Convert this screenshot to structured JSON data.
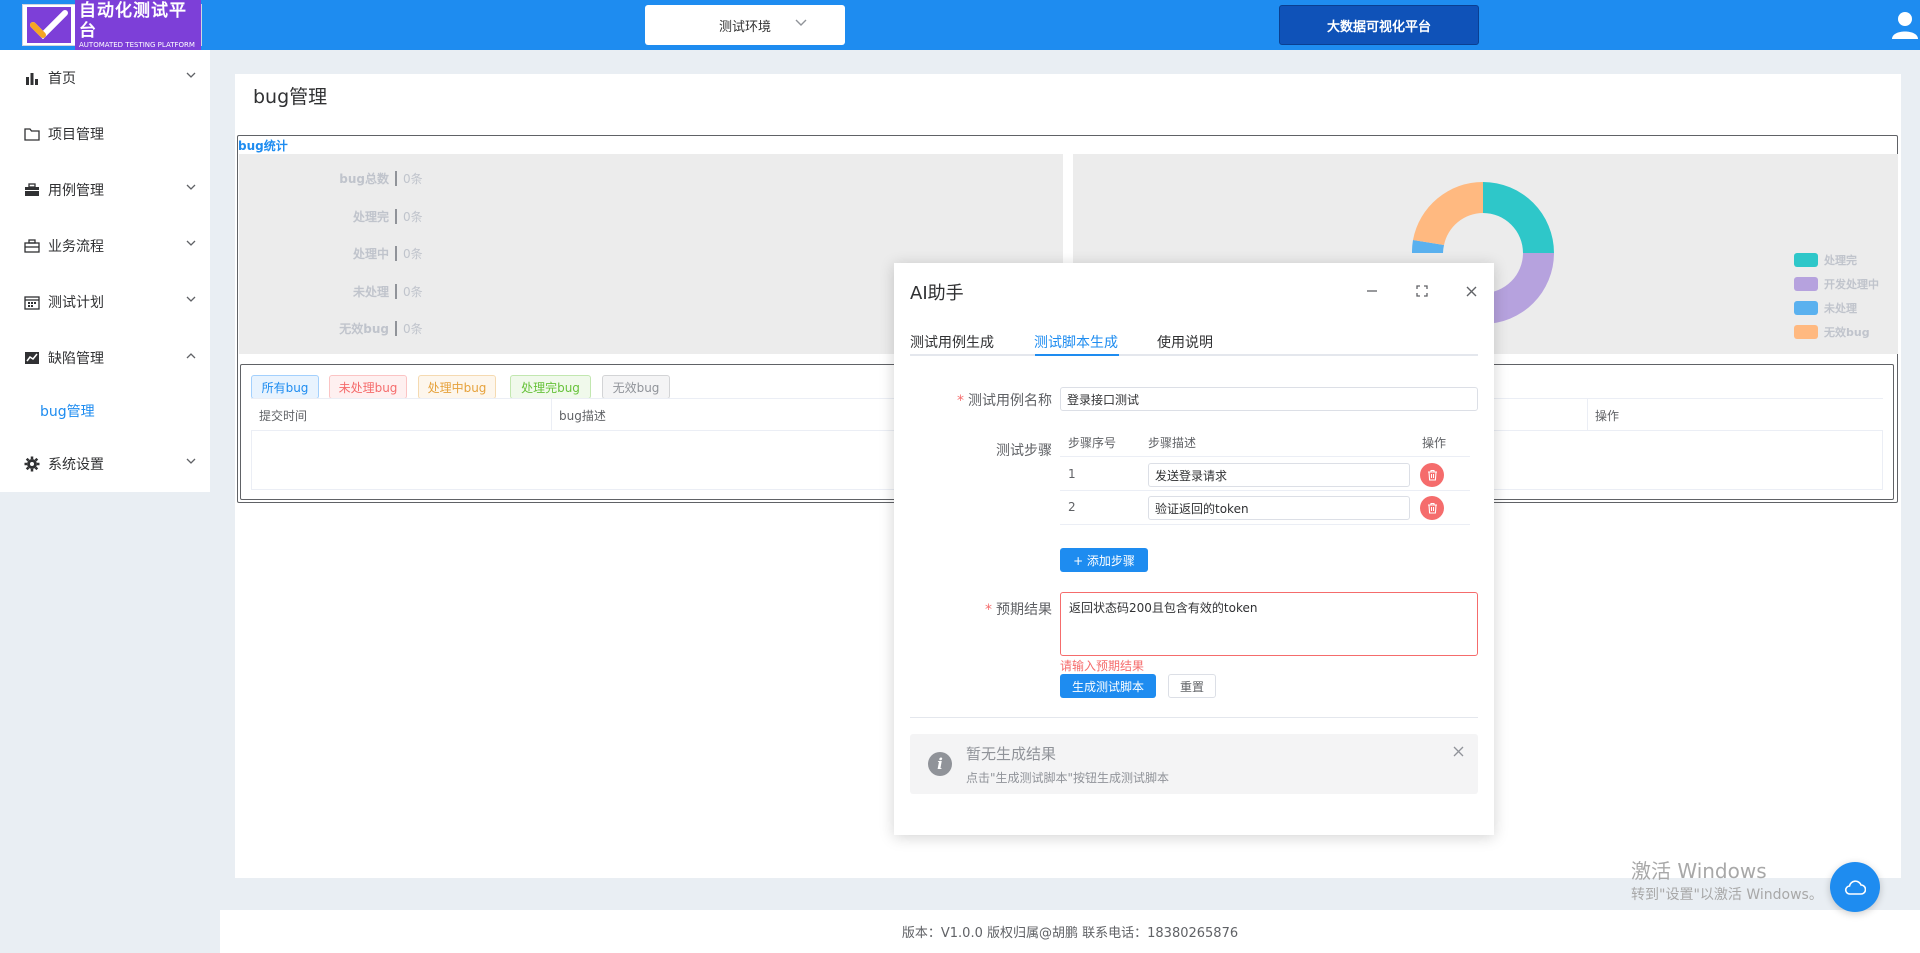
{
  "header": {
    "logo_title": "自动化测试平台",
    "logo_sub": "AUTOMATED TESTING PLATFORM",
    "env_select": "测试环境",
    "bigdata_button": "大数据可视化平台",
    "brand_color": "#1e8cf0"
  },
  "sidebar": {
    "items": [
      {
        "label": "首页",
        "icon": "bar-chart-icon",
        "arrow": "down"
      },
      {
        "label": "项目管理",
        "icon": "folder-icon",
        "arrow": ""
      },
      {
        "label": "用例管理",
        "icon": "briefcase-icon",
        "arrow": "down"
      },
      {
        "label": "业务流程",
        "icon": "suitcase-icon",
        "arrow": "down"
      },
      {
        "label": "测试计划",
        "icon": "calendar-icon",
        "arrow": "down"
      },
      {
        "label": "缺陷管理",
        "icon": "line-chart-icon",
        "arrow": "up"
      },
      {
        "label": "系统设置",
        "icon": "gear-icon",
        "arrow": "down"
      }
    ],
    "sub_item": "bug管理"
  },
  "main": {
    "title": "bug管理",
    "stats_label": "bug统计",
    "stats": [
      {
        "key": "bug总数",
        "value": "0条"
      },
      {
        "key": "处理完",
        "value": "0条"
      },
      {
        "key": "处理中",
        "value": "0条"
      },
      {
        "key": "未处理",
        "value": "0条"
      },
      {
        "key": "无效bug",
        "value": "0条"
      }
    ],
    "legend": [
      {
        "label": "处理完",
        "color": "#2ec7c9"
      },
      {
        "label": "开发处理中",
        "color": "#b6a2de"
      },
      {
        "label": "未处理",
        "color": "#5ab1ef"
      },
      {
        "label": "无效bug",
        "color": "#ffb980"
      }
    ],
    "tags": [
      {
        "label": "所有bug",
        "color": "#1e8cf0",
        "bg": "#e8f3fe",
        "border": "#a3d0fd"
      },
      {
        "label": "未处理bug",
        "color": "#f56c6c",
        "bg": "#fef0f0",
        "border": "#fbc4c4"
      },
      {
        "label": "处理中bug",
        "color": "#e6a23c",
        "bg": "#fdf6ec",
        "border": "#f5dab1"
      },
      {
        "label": "处理完bug",
        "color": "#67c23a",
        "bg": "#f0f9eb",
        "border": "#c2e7b0"
      },
      {
        "label": "无效bug",
        "color": "#909399",
        "bg": "#f4f4f5",
        "border": "#d3d4d6"
      }
    ],
    "table_headers": [
      "提交时间",
      "bug描述",
      "操作"
    ]
  },
  "footer": "版本：V1.0.0 版权归属@胡鹏 联系电话：18380265876",
  "watermark": {
    "line1": "激活 Windows",
    "line2": "转到\"设置\"以激活 Windows。"
  },
  "dialog": {
    "title": "AI助手",
    "tabs": [
      "测试用例生成",
      "测试脚本生成",
      "使用说明"
    ],
    "active_tab": 1,
    "case_name_label": "测试用例名称",
    "case_name_value": "登录接口测试",
    "steps_label": "测试步骤",
    "steps_headers": [
      "步骤序号",
      "步骤描述",
      "操作"
    ],
    "steps": [
      {
        "no": "1",
        "desc": "发送登录请求"
      },
      {
        "no": "2",
        "desc": "验证返回的token"
      }
    ],
    "add_step_label": "+ 添加步骤",
    "expected_label": "预期结果",
    "expected_value": "返回状态码200且包含有效的token",
    "error_text": "请输入预期结果",
    "generate_button": "生成测试脚本",
    "reset_button": "重置",
    "alert_title": "暂无生成结果",
    "alert_desc": "点击\"生成测试脚本\"按钮生成测试脚本"
  }
}
